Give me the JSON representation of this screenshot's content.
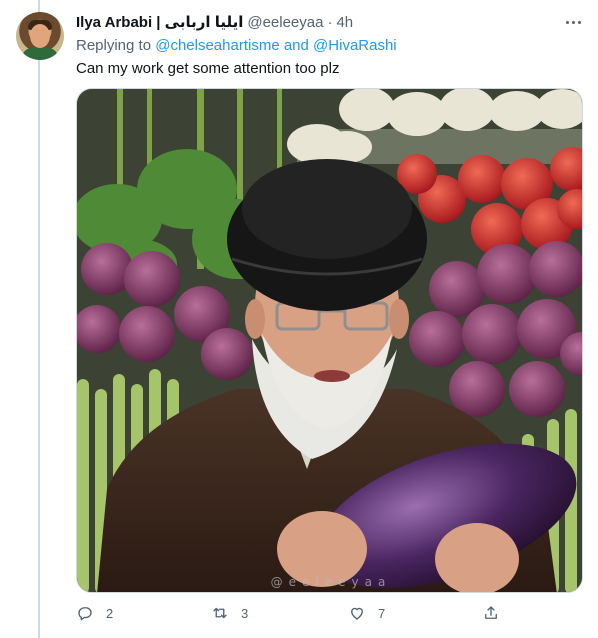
{
  "tweet": {
    "display_name": "Ilya Arbabi | ایلیا اربابی",
    "handle": "@eeleeyaa",
    "separator": "·",
    "time": "4h",
    "reply_prefix": "Replying to",
    "reply_user_1": "@chelseahartisme",
    "reply_and": "and",
    "reply_user_2": "@HivaRashi",
    "text": "Can my work get some attention too plz",
    "media_watermark": "@eeleeyaa"
  },
  "actions": {
    "reply_count": "2",
    "retweet_count": "3",
    "like_count": "7"
  },
  "icons": [
    "more-icon",
    "reply-icon",
    "retweet-icon",
    "like-icon",
    "share-icon"
  ],
  "colors": {
    "link": "#1d9bf0",
    "muted": "#536471",
    "text": "#0f1419"
  }
}
